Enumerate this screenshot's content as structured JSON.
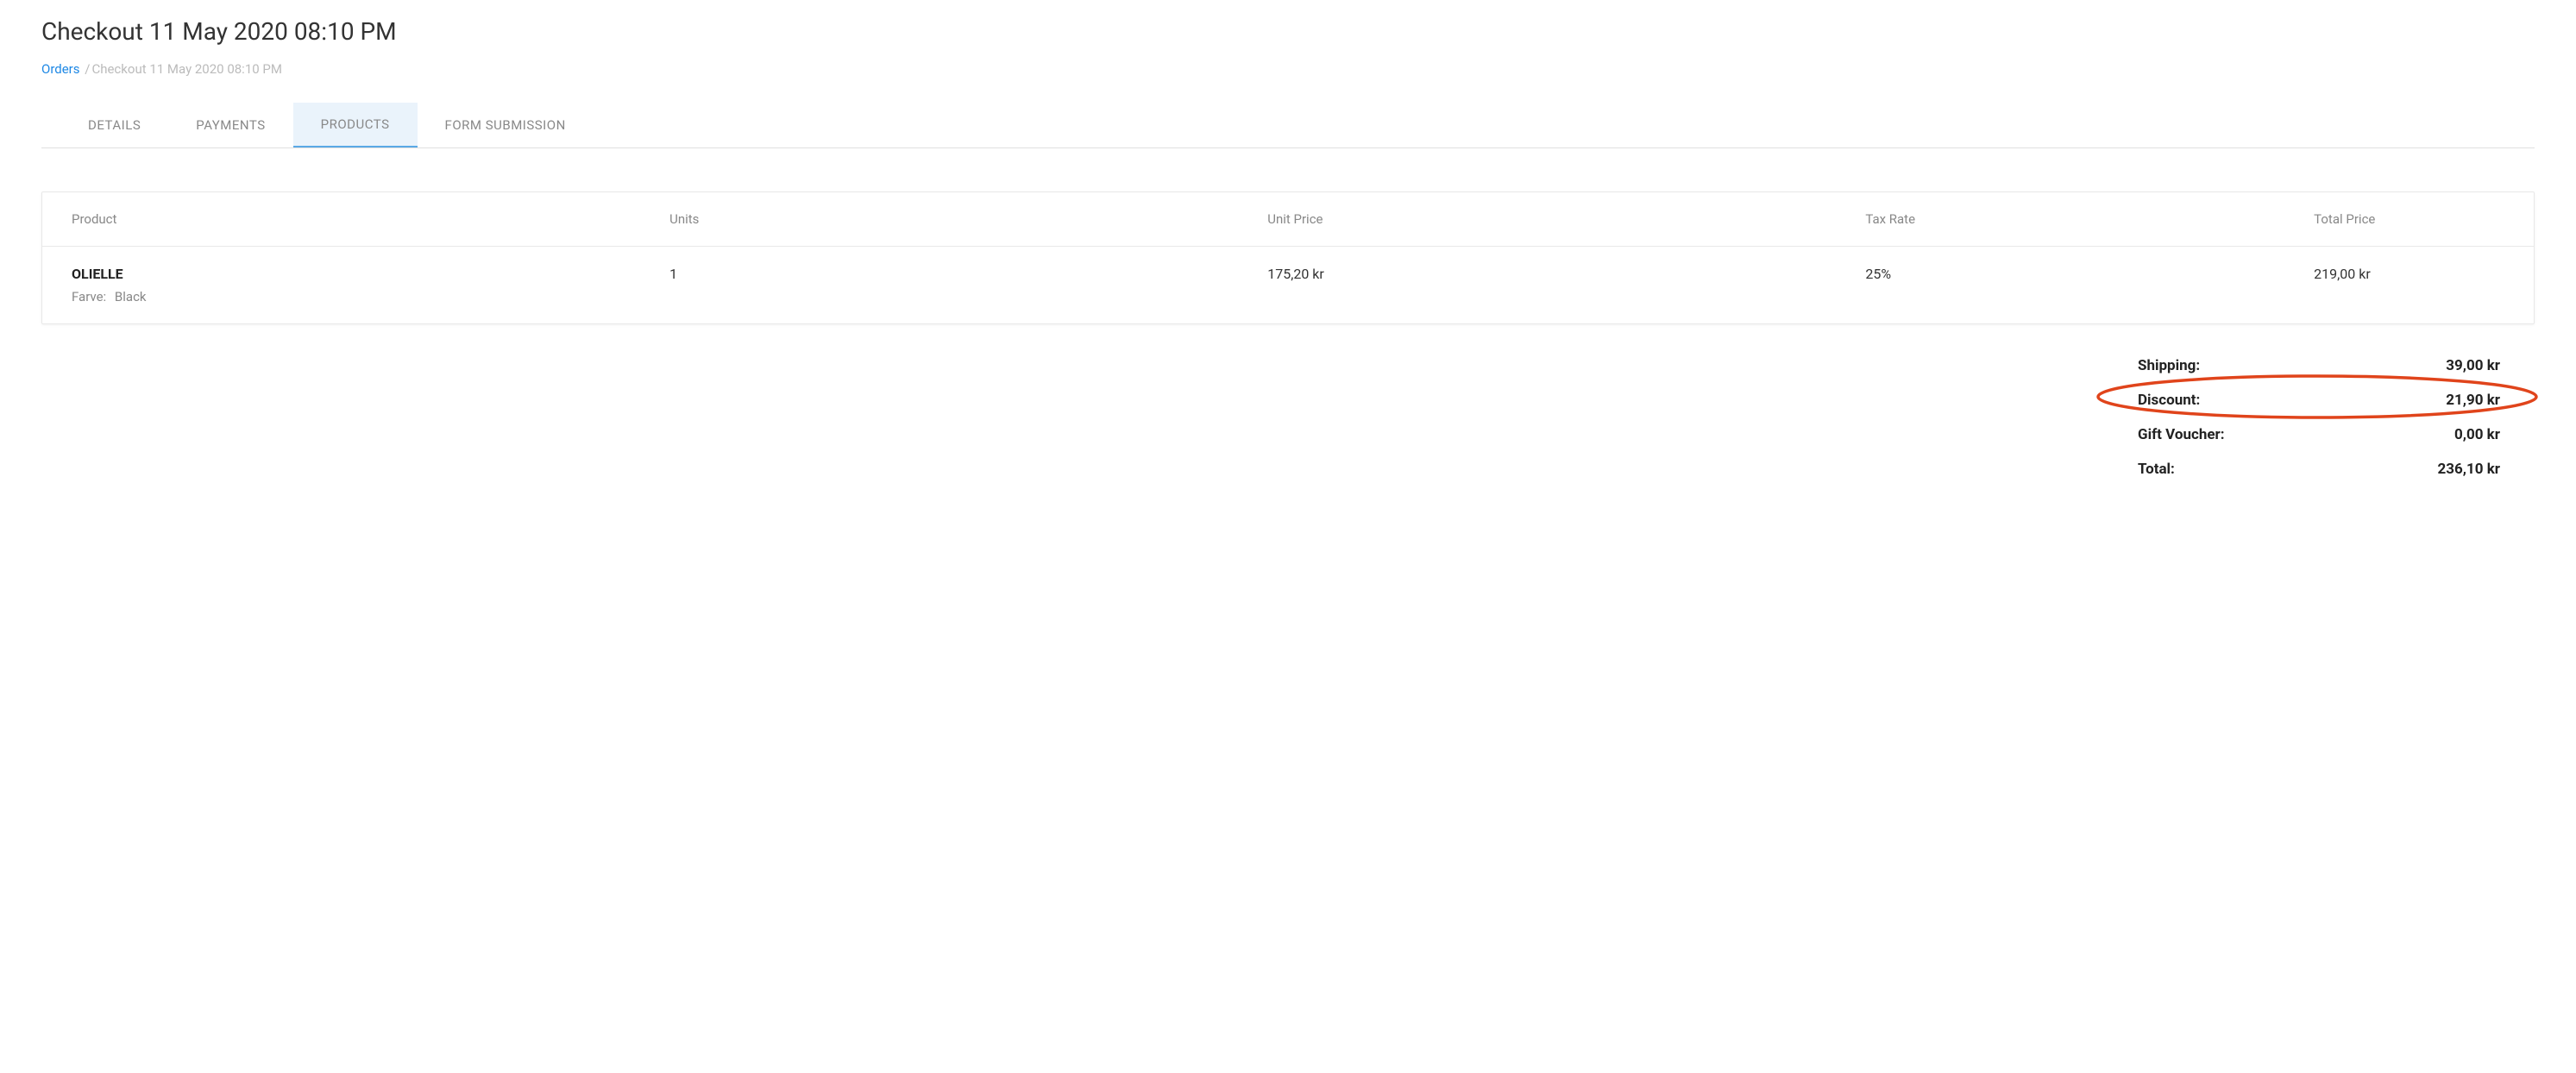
{
  "page_title": "Checkout 11 May 2020 08:10 PM",
  "breadcrumb": {
    "link_label": "Orders",
    "current": "Checkout 11 May 2020 08:10 PM"
  },
  "tabs": [
    {
      "label": "DETAILS"
    },
    {
      "label": "PAYMENTS"
    },
    {
      "label": "PRODUCTS"
    },
    {
      "label": "FORM SUBMISSION"
    }
  ],
  "table": {
    "headers": {
      "product": "Product",
      "units": "Units",
      "unit_price": "Unit Price",
      "tax_rate": "Tax Rate",
      "total_price": "Total Price"
    },
    "rows": [
      {
        "name": "OLIELLE",
        "attr_label": "Farve:",
        "attr_value": "Black",
        "units": "1",
        "unit_price": "175,20 kr",
        "tax_rate": "25%",
        "total_price": "219,00 kr"
      }
    ]
  },
  "summary": {
    "shipping_label": "Shipping:",
    "shipping_value": "39,00 kr",
    "discount_label": "Discount:",
    "discount_value": "21,90 kr",
    "gift_voucher_label": "Gift Voucher:",
    "gift_voucher_value": "0,00 kr",
    "total_label": "Total:",
    "total_value": "236,10 kr"
  }
}
